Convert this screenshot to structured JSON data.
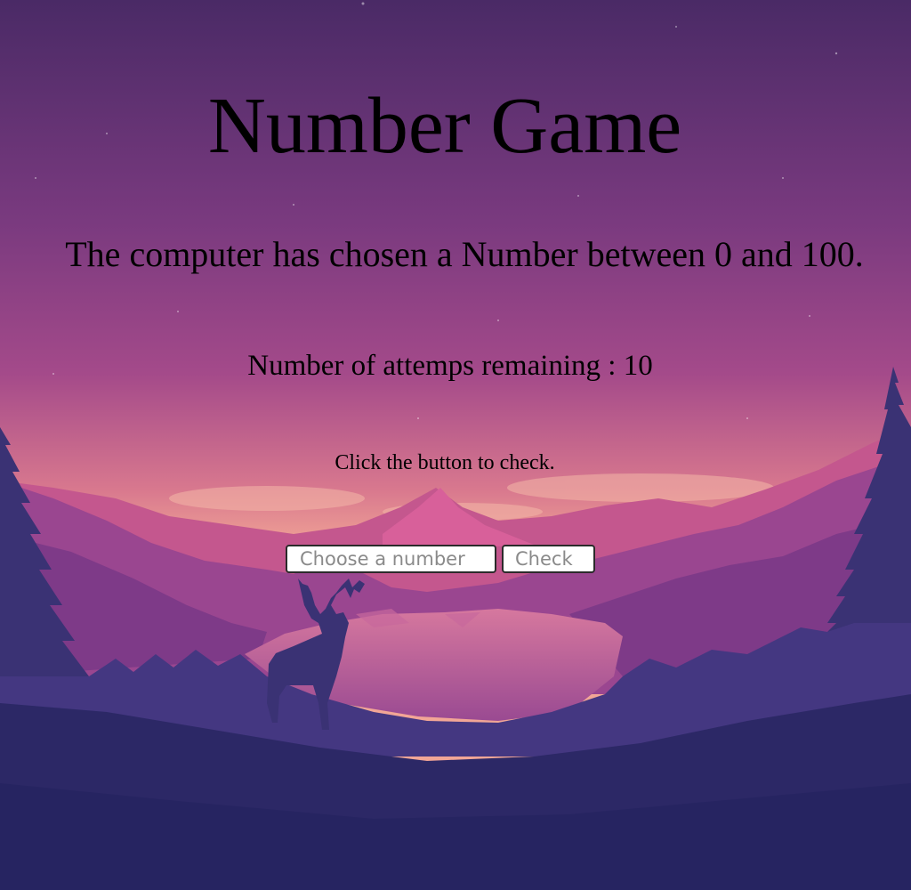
{
  "game": {
    "title": "Number Game",
    "intro": "The computer has chosen a Number between 0 and 100.",
    "attempts_label": "Number of attemps remaining : ",
    "attempts_remaining": "10",
    "hint": "Click the button to check."
  },
  "form": {
    "input_placeholder": "Choose a number",
    "input_value": "",
    "check_label": "Check"
  },
  "colors": {
    "sky_top": "#4a2a66",
    "sky_mid": "#9a3f86",
    "sky_horizon": "#e88c8c",
    "mountain_far": "#b04b8a",
    "mountain_mid": "#7a3a82",
    "forest_dark": "#362e70",
    "ground": "#2a2762"
  },
  "background": {
    "scene": "mountain-lake-sunset-with-deer-silhouette"
  }
}
